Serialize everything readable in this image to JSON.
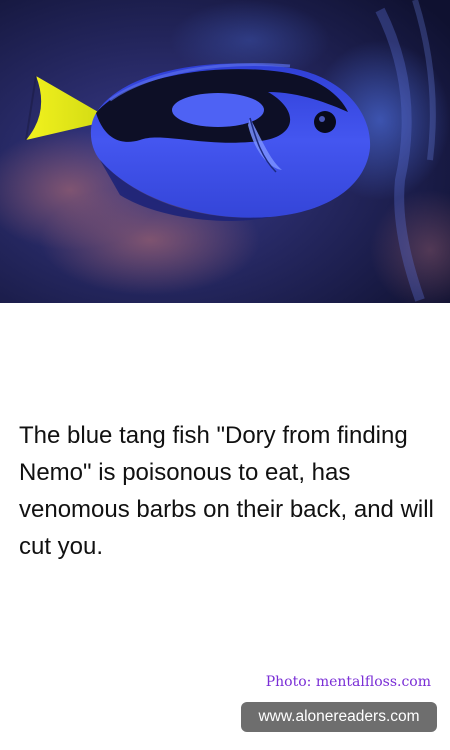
{
  "image": {
    "subject": "blue-tang-fish-photo"
  },
  "fact": {
    "text": "The blue tang fish \"Dory from finding Nemo\" is poisonous to eat, has venomous barbs on their back, and will cut you."
  },
  "credit": {
    "text": "Photo: mentalfloss.com"
  },
  "site": {
    "text": "www.alonereaders.com"
  },
  "colors": {
    "credit": "#7a2ed6",
    "badge_bg": "#6e6e6e",
    "fish_body": "#3b4fe6",
    "fish_tail": "#e6e61a"
  }
}
